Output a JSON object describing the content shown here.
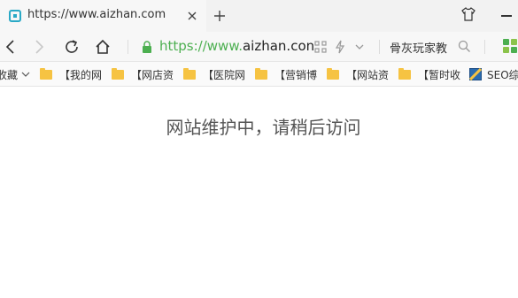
{
  "tab": {
    "title": "https://www.aizhan.com",
    "favicon": "aizhan-favicon",
    "accent": "#2aa9c6"
  },
  "toolbar": {
    "icons": [
      "back-icon",
      "forward-icon",
      "reload-icon",
      "home-icon",
      "qr-code-icon",
      "lightning-icon",
      "chevron-down-icon",
      "search-icon",
      "extensions-icon",
      "tshirt-icon",
      "minimize-icon",
      "close-icon",
      "plus-icon"
    ]
  },
  "address": {
    "scheme": "https://",
    "prefix": "www.",
    "host": "aizhan.con",
    "lock_color": "#4caf50"
  },
  "search": {
    "text": "骨灰玩家教"
  },
  "bookmarks": {
    "items": [
      {
        "label": "收藏"
      },
      {
        "label": "【我的网"
      },
      {
        "label": "【网店资"
      },
      {
        "label": "【医院网"
      },
      {
        "label": "【营销博"
      },
      {
        "label": "【网站资"
      },
      {
        "label": "【暂时收"
      },
      {
        "label": "SEO综"
      }
    ],
    "folder_color": "#f6c342"
  },
  "page": {
    "message": "网站维护中，请稍后访问"
  }
}
